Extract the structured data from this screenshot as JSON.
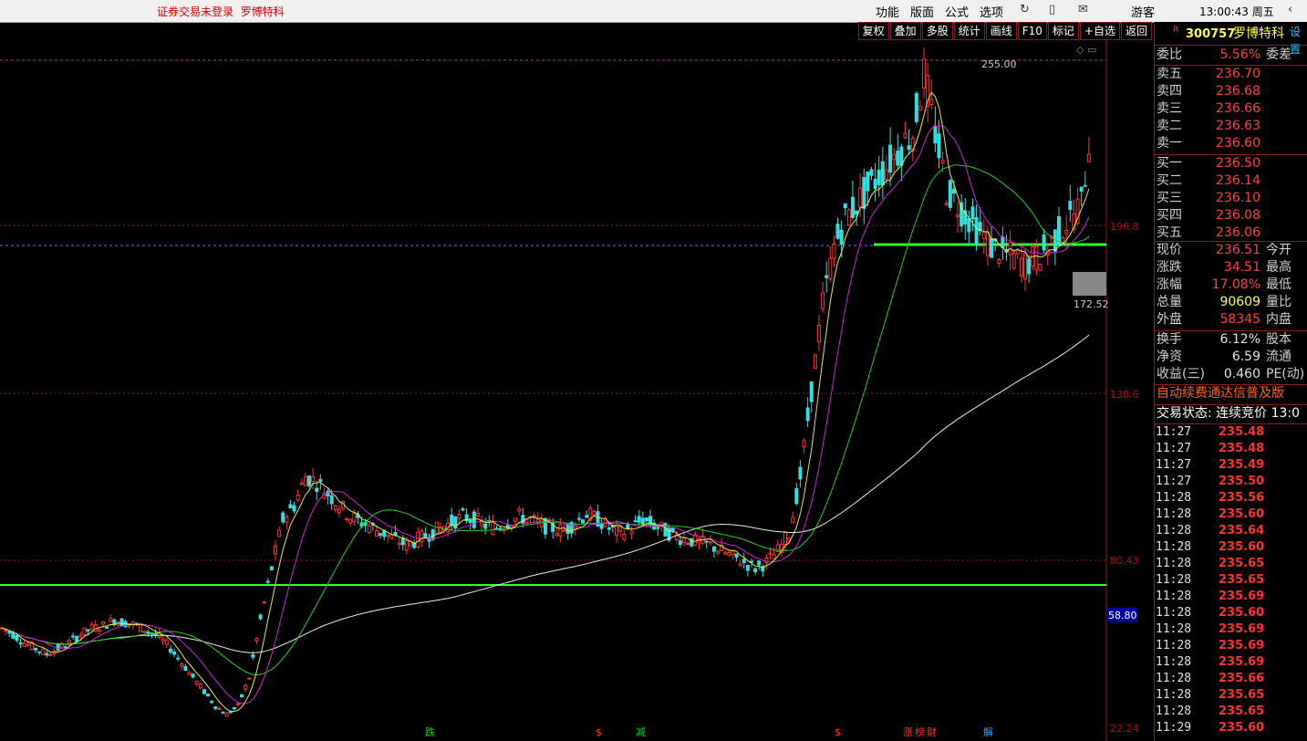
{
  "topbar": {
    "warning": "证券交易未登录",
    "stock_name": "罗博特科",
    "menu": [
      "功能",
      "版面",
      "公式",
      "选项"
    ],
    "guest": "游客",
    "clock": "13:00:43 周五"
  },
  "toolbar": {
    "buttons": [
      "复权",
      "叠加",
      "多股",
      "统计",
      "画线",
      "F10",
      "标记",
      "+自选",
      "返回"
    ]
  },
  "chart_data": {
    "type": "candlestick",
    "title": "",
    "y_ticks": [
      "196.8",
      "138.6",
      "80.43",
      "22.24"
    ],
    "price_high_label": "255.00",
    "price_low_label": "172.52",
    "current_level_label": "58.80",
    "event_markers": [
      "跌",
      "$",
      "减",
      "$",
      "涨",
      "榜",
      "财",
      "解"
    ],
    "ylim": [
      22.24,
      255.0
    ],
    "price_path": [
      57,
      55,
      52,
      50,
      48,
      50,
      52,
      55,
      57,
      58,
      60,
      59,
      58,
      56,
      54,
      50,
      45,
      40,
      35,
      30,
      27,
      30,
      40,
      60,
      78,
      95,
      100,
      110,
      108,
      104,
      100,
      96,
      94,
      92,
      90,
      88,
      86,
      88,
      90,
      92,
      94,
      96,
      95,
      93,
      92,
      94,
      96,
      95,
      93,
      92,
      91,
      94,
      97,
      95,
      92,
      90,
      92,
      95,
      93,
      91,
      89,
      88,
      87,
      86,
      84,
      82,
      80,
      78,
      80,
      84,
      90,
      110,
      140,
      170,
      190,
      200,
      205,
      210,
      215,
      220,
      225,
      230,
      250,
      230,
      210,
      205,
      200,
      195,
      190,
      188,
      186,
      184,
      186,
      190,
      195,
      200,
      205,
      236.51
    ]
  },
  "panel": {
    "code": "300757",
    "name": "罗博特科",
    "setup": "设置",
    "weibi_label": "委比",
    "weibi_value": "5.56%",
    "weicha_label": "委差",
    "asks": [
      {
        "l": "卖五",
        "p": "236.70"
      },
      {
        "l": "卖四",
        "p": "236.68"
      },
      {
        "l": "卖三",
        "p": "236.66"
      },
      {
        "l": "卖二",
        "p": "236.63"
      },
      {
        "l": "卖一",
        "p": "236.60"
      }
    ],
    "bids": [
      {
        "l": "买一",
        "p": "236.50"
      },
      {
        "l": "买二",
        "p": "236.14"
      },
      {
        "l": "买三",
        "p": "236.10"
      },
      {
        "l": "买四",
        "p": "236.08"
      },
      {
        "l": "买五",
        "p": "236.06"
      }
    ],
    "stats": [
      {
        "l": "现价",
        "v": "236.51",
        "r": "今开"
      },
      {
        "l": "涨跌",
        "v": "34.51",
        "r": "最高"
      },
      {
        "l": "涨幅",
        "v": "17.08%",
        "r": "最低"
      },
      {
        "l": "总量",
        "v": "90609",
        "r": "量比"
      },
      {
        "l": "外盘",
        "v": "58345",
        "r": "内盘"
      }
    ],
    "stats2": [
      {
        "l": "换手",
        "v": "6.12%",
        "r": "股本"
      },
      {
        "l": "净资",
        "v": "6.59",
        "r": "流通"
      },
      {
        "l": "收益(三)",
        "v": "0.460",
        "r": "PE(动)"
      }
    ],
    "promo": "自动续费通达信普及版",
    "status": "交易状态: 连续竞价 13:0",
    "ticks": [
      {
        "t": "11:27",
        "p": "235.48"
      },
      {
        "t": "11:27",
        "p": "235.48"
      },
      {
        "t": "11:27",
        "p": "235.49"
      },
      {
        "t": "11:27",
        "p": "235.50"
      },
      {
        "t": "11:28",
        "p": "235.56"
      },
      {
        "t": "11:28",
        "p": "235.60"
      },
      {
        "t": "11:28",
        "p": "235.64"
      },
      {
        "t": "11:28",
        "p": "235.60"
      },
      {
        "t": "11:28",
        "p": "235.65"
      },
      {
        "t": "11:28",
        "p": "235.65"
      },
      {
        "t": "11:28",
        "p": "235.69"
      },
      {
        "t": "11:28",
        "p": "235.60"
      },
      {
        "t": "11:28",
        "p": "235.69"
      },
      {
        "t": "11:28",
        "p": "235.69"
      },
      {
        "t": "11:28",
        "p": "235.69"
      },
      {
        "t": "11:28",
        "p": "235.66"
      },
      {
        "t": "11:28",
        "p": "235.65"
      },
      {
        "t": "11:28",
        "p": "235.65"
      },
      {
        "t": "11:29",
        "p": "235.60"
      }
    ]
  }
}
